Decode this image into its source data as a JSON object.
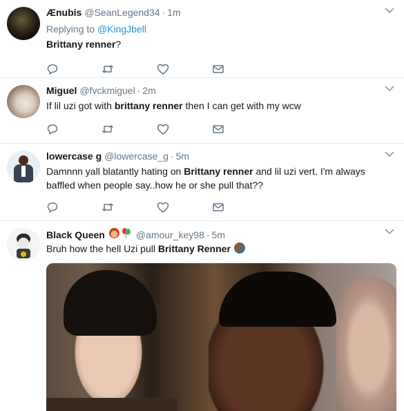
{
  "tweets": [
    {
      "name": "Ænubis",
      "handle": "@SeanLegend34",
      "sep": "·",
      "time": "1m",
      "replying_prefix": "Replying to ",
      "replying_to": "@KingJbell",
      "text_bold": "Brittany renner",
      "text_rest": "?"
    },
    {
      "name": "Miguel",
      "handle": "@fvckmiguel",
      "sep": "·",
      "time": "2m",
      "text_a": "If lil uzi got with ",
      "text_bold": "brittany renner",
      "text_b": " then I can get with my wcw"
    },
    {
      "name": "lowercase g",
      "handle": "@lowercase_g",
      "sep": "·",
      "time": "5m",
      "text_a": "Damnnn yall blatantly hating on ",
      "text_bold": "Brittany renner",
      "text_b": " and lil uzi vert. I'm always baffled when people say..how he or she pull that??"
    },
    {
      "name": "Black Queen",
      "handle": "@amour_key98",
      "sep": "·",
      "time": "5m",
      "text_a": "Bruh how the hell Uzi pull ",
      "text_bold": "Brittany Renner"
    }
  ],
  "icons": {
    "reply": "reply-icon",
    "retweet": "retweet-icon",
    "like": "heart-icon",
    "dm": "envelope-icon",
    "more": "chevron-down-icon"
  },
  "colors": {
    "text": "#14171a",
    "secondary": "#657786",
    "link": "#1b95e0",
    "divider": "#e6ecf0"
  }
}
